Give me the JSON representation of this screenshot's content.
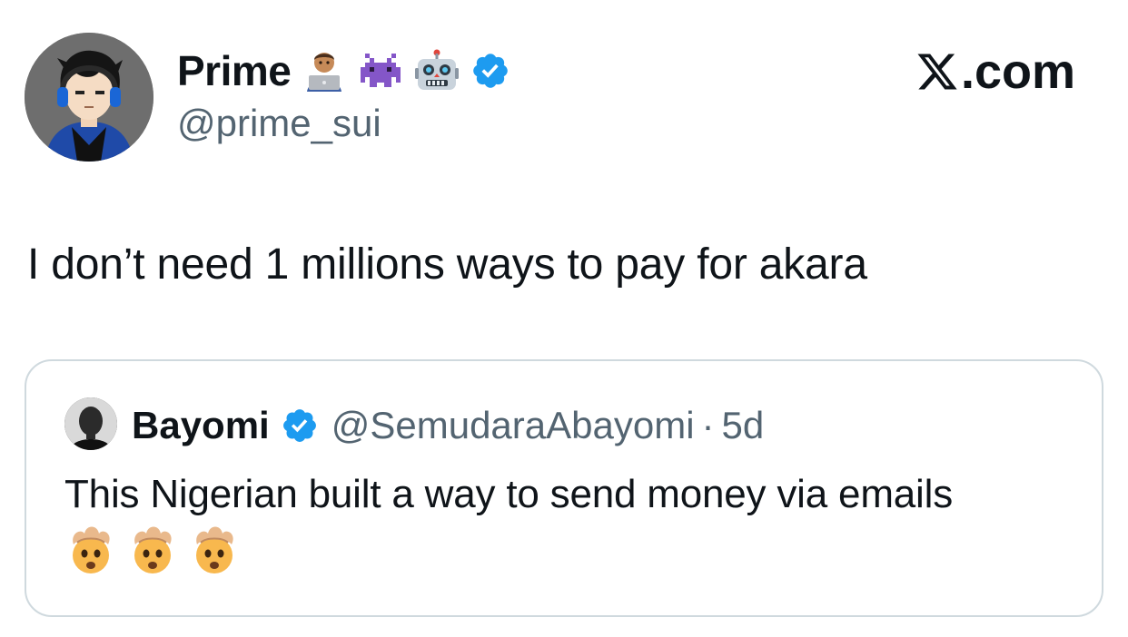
{
  "author": {
    "display_name": "Prime",
    "handle": "@prime_sui",
    "verified": true,
    "badges": [
      "technologist-emoji",
      "alien-monster-emoji",
      "robot-emoji"
    ]
  },
  "brand": {
    "label": ".com",
    "logo": "x-logo-icon"
  },
  "tweet": {
    "text": "I don’t need 1 millions ways to pay for akara"
  },
  "quoted": {
    "display_name": "Bayomi",
    "handle": "@SemudaraAbayomi",
    "separator": "·",
    "time": "5d",
    "verified": true,
    "text": "This Nigerian built a way to send money via emails",
    "emojis": [
      "exploding-head-emoji",
      "exploding-head-emoji",
      "exploding-head-emoji"
    ]
  },
  "colors": {
    "verified_blue": "#1d9bf0",
    "text_primary": "#0f1419",
    "text_secondary": "#536471",
    "border": "#cfd9de"
  }
}
